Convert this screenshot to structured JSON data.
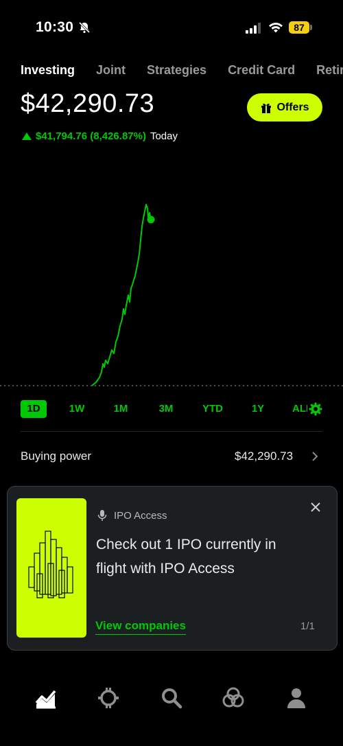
{
  "status_bar": {
    "time": "10:30",
    "battery": "87"
  },
  "tabs": [
    {
      "label": "Investing",
      "active": true
    },
    {
      "label": "Joint"
    },
    {
      "label": "Strategies"
    },
    {
      "label": "Credit Card"
    },
    {
      "label": "Retire"
    }
  ],
  "portfolio": {
    "value": "$42,290.73",
    "change": "$41,794.76 (8,426.87%)",
    "change_period": "Today"
  },
  "offers_button": {
    "label": "Offers"
  },
  "ranges": [
    {
      "label": "1D",
      "active": true
    },
    {
      "label": "1W"
    },
    {
      "label": "1M"
    },
    {
      "label": "3M"
    },
    {
      "label": "YTD"
    },
    {
      "label": "1Y"
    },
    {
      "label": "ALL"
    }
  ],
  "buying_power": {
    "label": "Buying power",
    "value": "$42,290.73"
  },
  "ipo_card": {
    "eyebrow": "IPO Access",
    "body": "Check out 1 IPO currently in flight with IPO Access",
    "link": "View companies",
    "pager": "1/1"
  },
  "colors": {
    "accent": "#00c805",
    "brand_lime": "#ccff00",
    "background": "#000000"
  },
  "nav": [
    "chart-icon",
    "crypto-icon",
    "search-icon",
    "network-icon",
    "account-icon"
  ]
}
